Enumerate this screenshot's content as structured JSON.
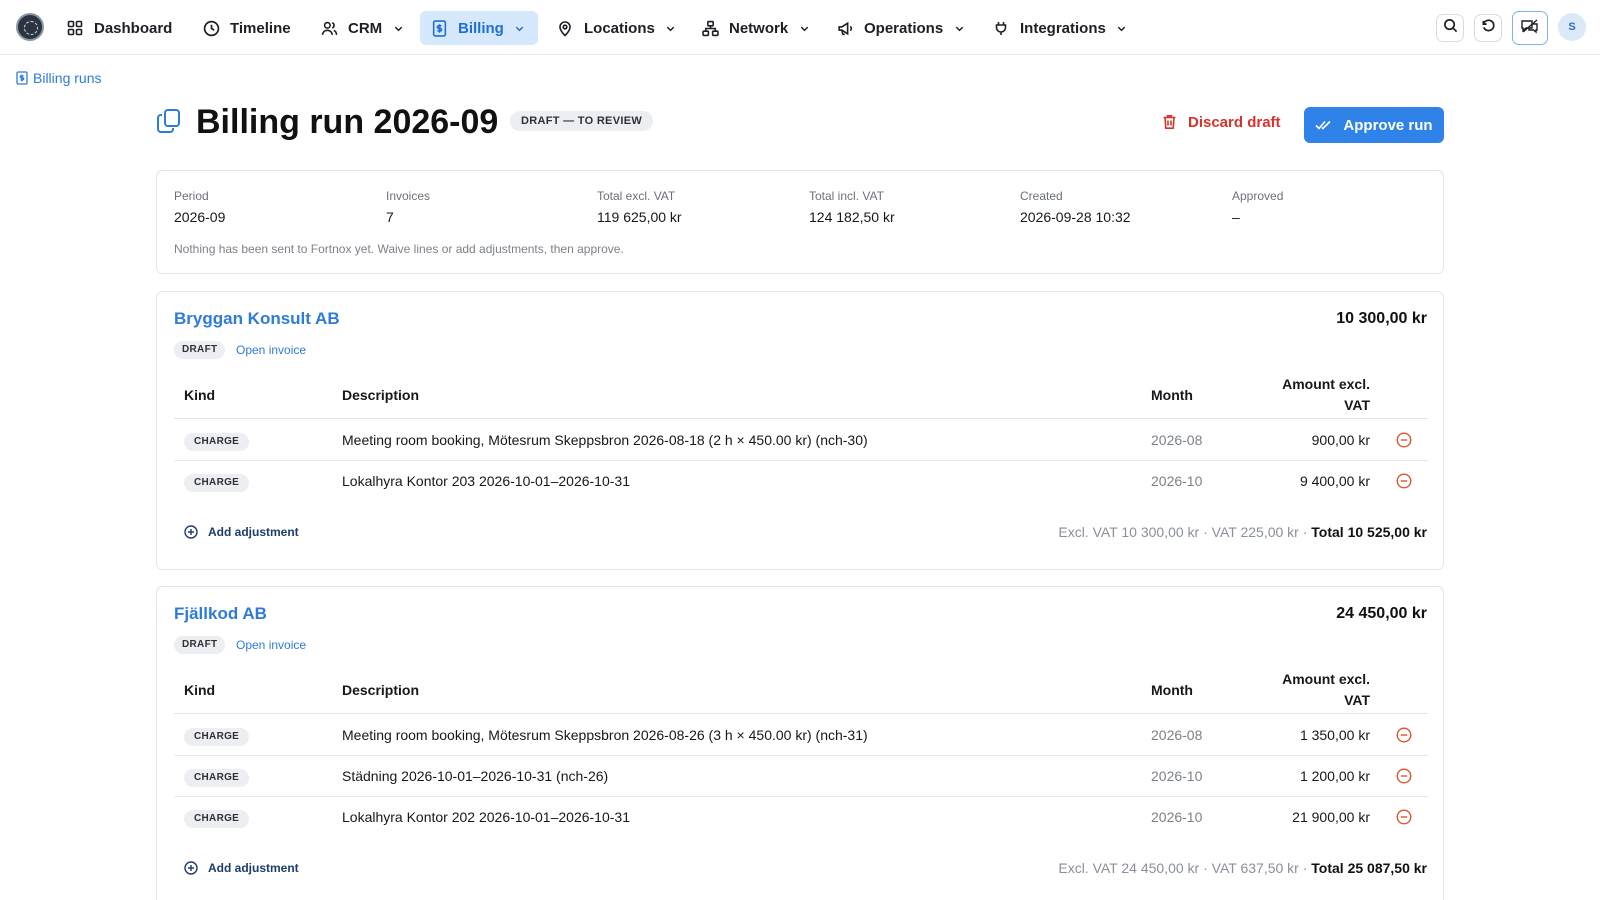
{
  "nav": {
    "items": [
      {
        "label": "Dashboard",
        "icon": "grid-icon",
        "dropdown": false
      },
      {
        "label": "Timeline",
        "icon": "clock-icon",
        "dropdown": false
      },
      {
        "label": "CRM",
        "icon": "users-icon",
        "dropdown": true
      },
      {
        "label": "Billing",
        "icon": "receipt-icon",
        "dropdown": true,
        "active": true
      },
      {
        "label": "Locations",
        "icon": "map-pin-icon",
        "dropdown": true
      },
      {
        "label": "Network",
        "icon": "network-icon",
        "dropdown": true
      },
      {
        "label": "Operations",
        "icon": "megaphone-icon",
        "dropdown": true
      },
      {
        "label": "Integrations",
        "icon": "plug-icon",
        "dropdown": true
      }
    ],
    "avatar_initial": "S"
  },
  "breadcrumb": {
    "label": "Billing runs"
  },
  "header": {
    "title": "Billing run 2026-09",
    "status": "DRAFT — TO REVIEW",
    "discard_label": "Discard draft",
    "approve_label": "Approve run"
  },
  "summary": {
    "fields": [
      {
        "label": "Period",
        "value": "2026-09"
      },
      {
        "label": "Invoices",
        "value": "7"
      },
      {
        "label": "Total excl. VAT",
        "value": "119 625,00 kr"
      },
      {
        "label": "Total incl. VAT",
        "value": "124 182,50 kr"
      },
      {
        "label": "Created",
        "value": "2026-09-28 10:32"
      },
      {
        "label": "Approved",
        "value": "–"
      }
    ],
    "note": "Nothing has been sent to Fortnox yet. Waive lines or add adjustments, then approve."
  },
  "table_headers": {
    "kind": "Kind",
    "description": "Description",
    "month": "Month",
    "amount": "Amount excl. VAT"
  },
  "invoices": [
    {
      "customer": "Bryggan Konsult AB",
      "total": "10 300,00 kr",
      "status": "DRAFT",
      "open_label": "Open invoice",
      "lines": [
        {
          "kind": "CHARGE",
          "description": "Meeting room booking, Mötesrum Skeppsbron 2026-08-18 (2 h × 450.00 kr) (nch-30)",
          "month": "2026-08",
          "amount": "900,00 kr"
        },
        {
          "kind": "CHARGE",
          "description": "Lokalhyra Kontor 203 2026-10-01–2026-10-31",
          "month": "2026-10",
          "amount": "9 400,00 kr"
        }
      ],
      "adjust_label": "Add adjustment",
      "footer_excl": "Excl. VAT 10 300,00 kr",
      "footer_vat": "VAT 225,00 kr",
      "footer_total": "Total 10 525,00 kr"
    },
    {
      "customer": "Fjällkod AB",
      "total": "24 450,00 kr",
      "status": "DRAFT",
      "open_label": "Open invoice",
      "lines": [
        {
          "kind": "CHARGE",
          "description": "Meeting room booking, Mötesrum Skeppsbron 2026-08-26 (3 h × 450.00 kr) (nch-31)",
          "month": "2026-08",
          "amount": "1 350,00 kr"
        },
        {
          "kind": "CHARGE",
          "description": "Städning 2026-10-01–2026-10-31 (nch-26)",
          "month": "2026-10",
          "amount": "1 200,00 kr"
        },
        {
          "kind": "CHARGE",
          "description": "Lokalhyra Kontor 202 2026-10-01–2026-10-31",
          "month": "2026-10",
          "amount": "21 900,00 kr"
        }
      ],
      "adjust_label": "Add adjustment",
      "footer_excl": "Excl. VAT 24 450,00 kr",
      "footer_vat": "VAT 637,50 kr",
      "footer_total": "Total 25 087,50 kr"
    }
  ],
  "colors": {
    "accent": "#2f82e8",
    "danger": "#d6332b",
    "waive": "#e0532b"
  }
}
